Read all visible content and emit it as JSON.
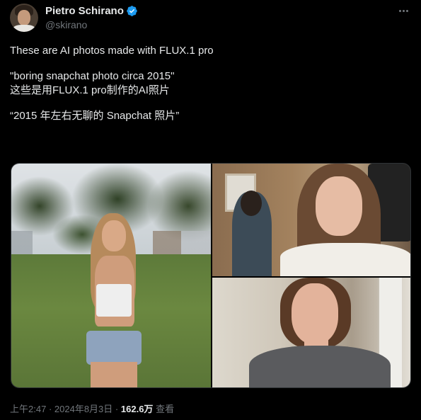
{
  "author": {
    "display_name": "Pietro Schirano",
    "handle": "@skirano",
    "verified": true,
    "verified_color": "#1d9bf0",
    "avatar_icon": "profile-avatar"
  },
  "tweet": {
    "lines": [
      "These are AI photos made with FLUX.1 pro",
      "\"boring snapchat photo circa 2015\"",
      "这些是用FLUX.1 pro制作的AI照片",
      "“2015 年左右无聊的 Snapchat 照片”"
    ]
  },
  "media": {
    "count": 3
  },
  "meta": {
    "time": "上午2:47",
    "separator": "·",
    "date": "2024年8月3日",
    "views_count": "162.6万",
    "views_label": "查看"
  },
  "colors": {
    "background": "#000000",
    "text_primary": "#e7e9ea",
    "text_secondary": "#71767b",
    "border": "#2f3336"
  },
  "icons": {
    "more": "more-dots-icon",
    "verified": "verified-badge-icon"
  }
}
